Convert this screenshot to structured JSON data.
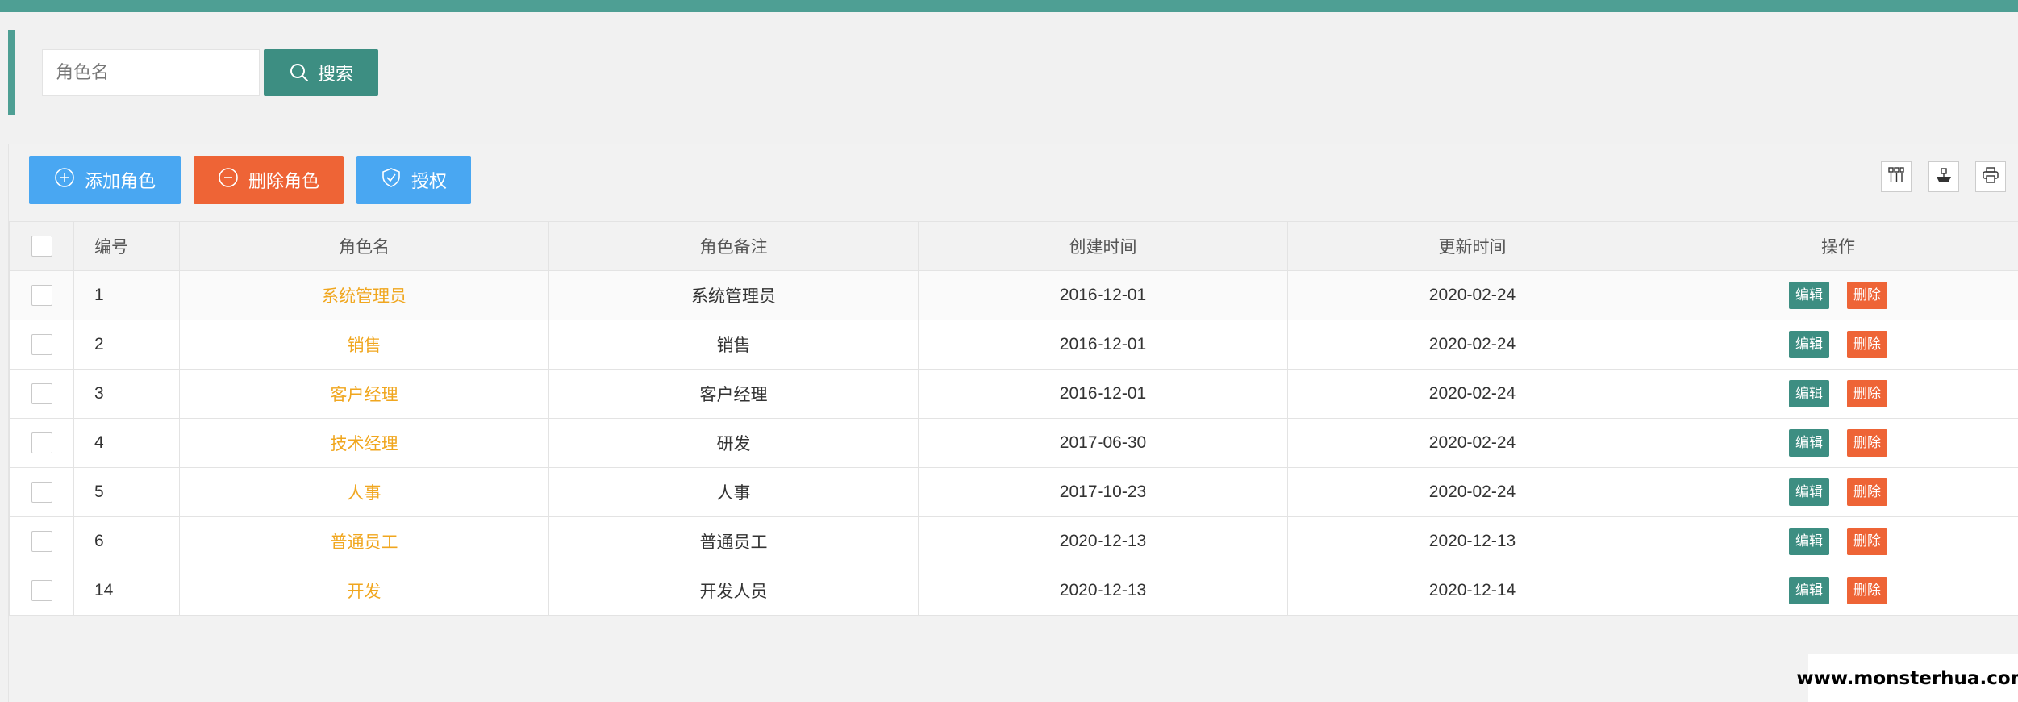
{
  "colors": {
    "accent": "#4e9f94",
    "primary_button": "#3d8e82",
    "blue_button": "#49a7f2",
    "danger_button": "#ee6436",
    "role_link": "#f0a61e"
  },
  "search": {
    "placeholder": "角色名",
    "button_label": "搜索",
    "button_icon": "search-icon"
  },
  "toolbar": {
    "add_label": "添加角色",
    "add_icon": "plus-circle-icon",
    "delete_label": "删除角色",
    "delete_icon": "minus-circle-icon",
    "auth_label": "授权",
    "auth_icon": "shield-check-icon",
    "right_icons": [
      "columns-icon",
      "export-icon",
      "print-icon"
    ]
  },
  "table": {
    "headers": {
      "id": "编号",
      "name": "角色名",
      "remark": "角色备注",
      "created": "创建时间",
      "updated": "更新时间",
      "actions": "操作"
    },
    "edit_label": "编辑",
    "delete_label": "删除",
    "rows": [
      {
        "id": "1",
        "name": "系统管理员",
        "remark": "系统管理员",
        "created": "2016-12-01",
        "updated": "2020-02-24"
      },
      {
        "id": "2",
        "name": "销售",
        "remark": "销售",
        "created": "2016-12-01",
        "updated": "2020-02-24"
      },
      {
        "id": "3",
        "name": "客户经理",
        "remark": "客户经理",
        "created": "2016-12-01",
        "updated": "2020-02-24"
      },
      {
        "id": "4",
        "name": "技术经理",
        "remark": "研发",
        "created": "2017-06-30",
        "updated": "2020-02-24"
      },
      {
        "id": "5",
        "name": "人事",
        "remark": "人事",
        "created": "2017-10-23",
        "updated": "2020-02-24"
      },
      {
        "id": "6",
        "name": "普通员工",
        "remark": "普通员工",
        "created": "2020-12-13",
        "updated": "2020-12-13"
      },
      {
        "id": "14",
        "name": "开发",
        "remark": "开发人员",
        "created": "2020-12-13",
        "updated": "2020-12-14"
      }
    ]
  },
  "watermark": "www.monsterhua.com"
}
